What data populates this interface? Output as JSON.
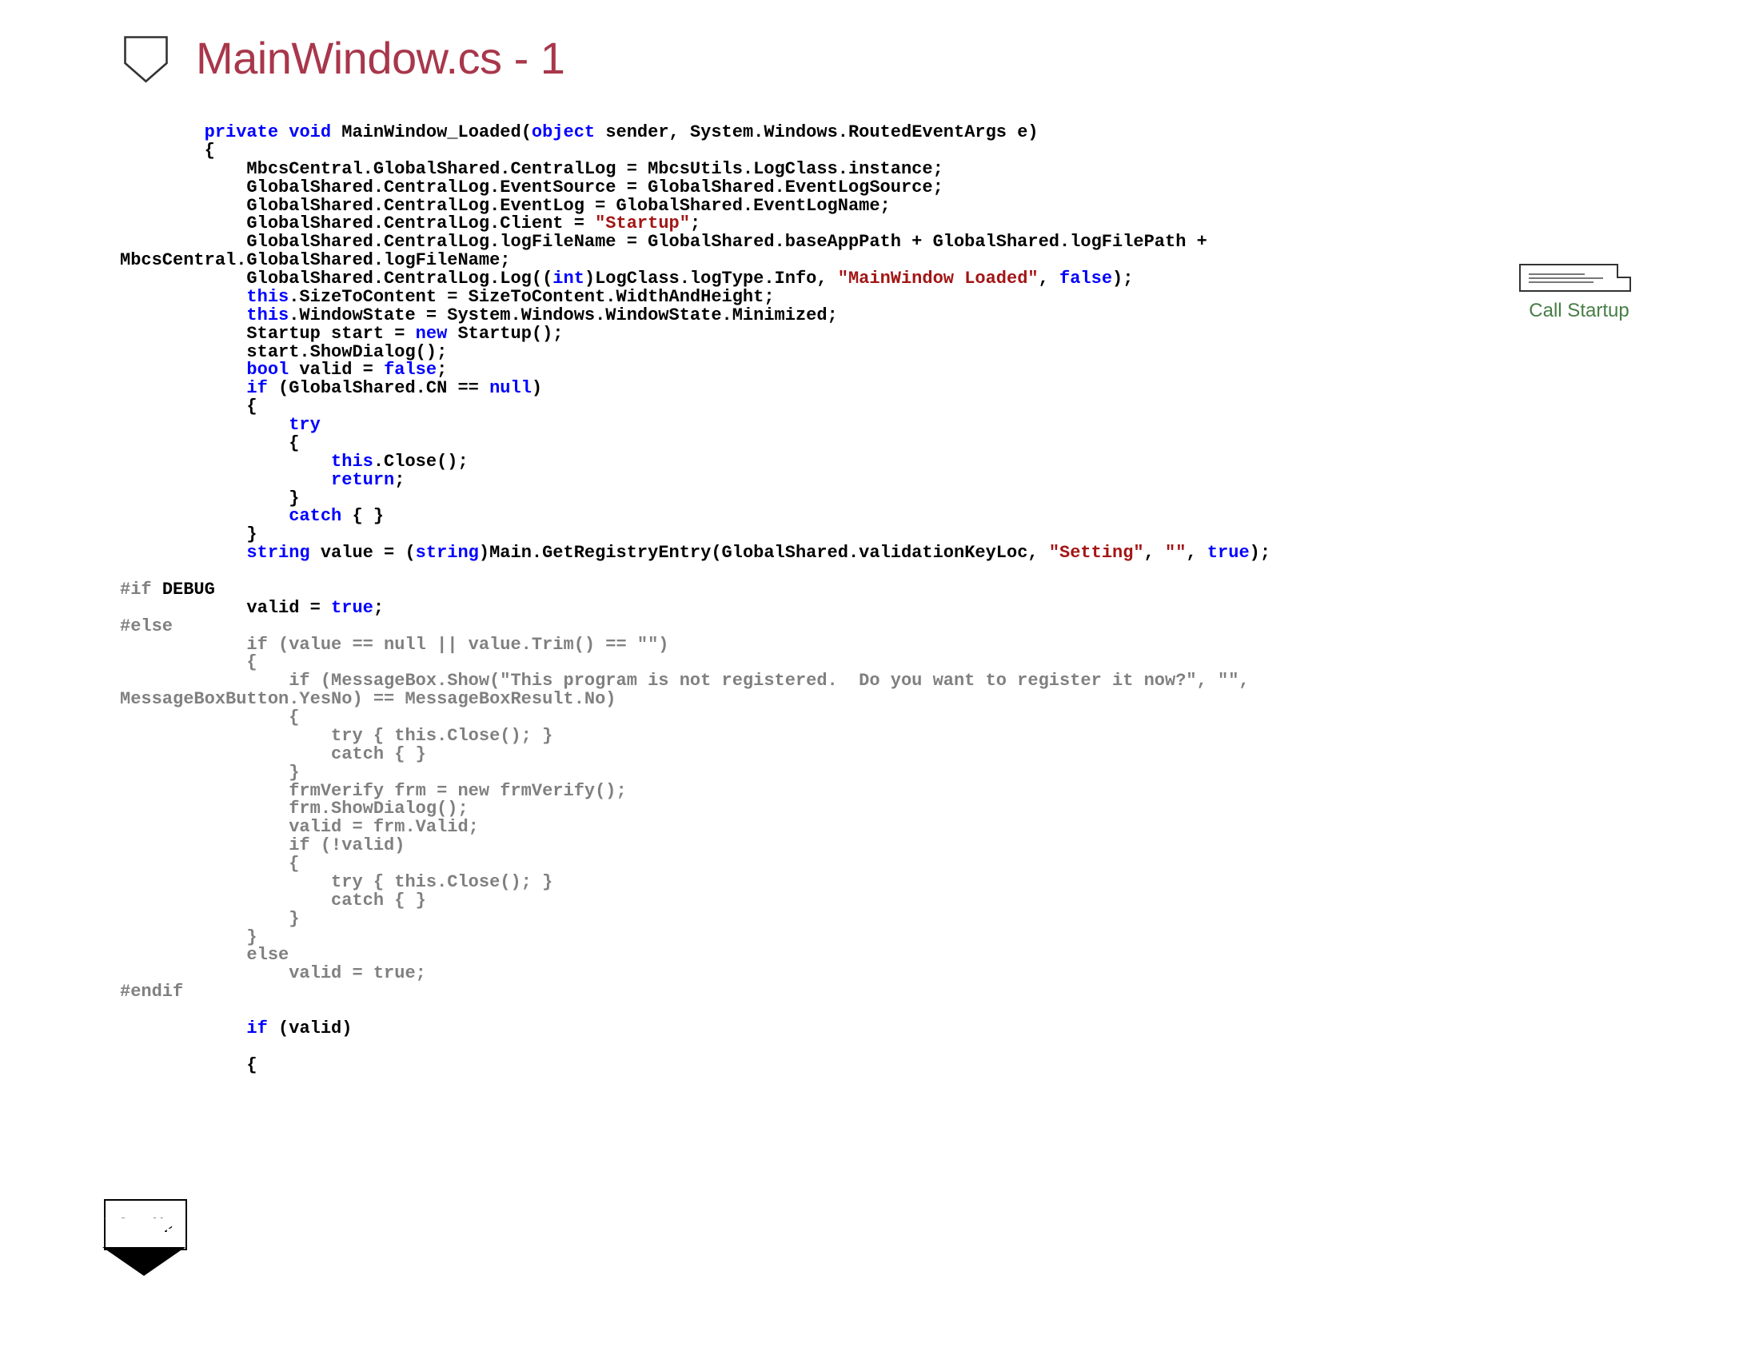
{
  "header": {
    "title": "MainWindow.cs - 1"
  },
  "callout": {
    "label": "Call Startup"
  },
  "startup_badge": {
    "label": "StartUp"
  },
  "code": {
    "l1a": "        private",
    "l1b": " void",
    "l1c": " MainWindow_Loaded(",
    "l1d": "object",
    "l1e": " sender, System.Windows.RoutedEventArgs e)",
    "l2": "        {",
    "l3": "            MbcsCentral.GlobalShared.CentralLog = MbcsUtils.LogClass.instance;",
    "l4": "            GlobalShared.CentralLog.EventSource = GlobalShared.EventLogSource;",
    "l5": "            GlobalShared.CentralLog.EventLog = GlobalShared.EventLogName;",
    "l6a": "            GlobalShared.CentralLog.Client = ",
    "l6b": "\"Startup\"",
    "l6c": ";",
    "l7": "            GlobalShared.CentralLog.logFileName = GlobalShared.baseAppPath + GlobalShared.logFilePath + ",
    "l7b": "MbcsCentral.GlobalShared.logFileName;",
    "l8a": "            GlobalShared.CentralLog.Log((",
    "l8b": "int",
    "l8c": ")LogClass.logType.Info, ",
    "l8d": "\"MainWindow Loaded\"",
    "l8e": ", ",
    "l8f": "false",
    "l8g": ");",
    "l9a": "            this",
    "l9b": ".SizeToContent = SizeToContent.WidthAndHeight;",
    "l10a": "            this",
    "l10b": ".WindowState = System.Windows.WindowState.Minimized;",
    "l11a": "            Startup start = ",
    "l11b": "new",
    "l11c": " Startup();",
    "l12": "            start.ShowDialog();",
    "l13a": "            bool",
    "l13b": " valid = ",
    "l13c": "false",
    "l13d": ";",
    "l14a": "            if",
    "l14b": " (GlobalShared.CN == ",
    "l14c": "null",
    "l14d": ")",
    "l15": "            {",
    "l16": "                try",
    "l17": "                {",
    "l18a": "                    this",
    "l18b": ".Close();",
    "l19": "                    return",
    "l19b": ";",
    "l20": "                }",
    "l21a": "                catch",
    "l21b": " { }",
    "l22": "            }",
    "l23a": "            string",
    "l23b": " value = (",
    "l23c": "string",
    "l23d": ")Main.GetRegistryEntry(GlobalShared.validationKeyLoc, ",
    "l23e": "\"Setting\"",
    "l23f": ", ",
    "l23g": "\"\"",
    "l23h": ", ",
    "l23i": "true",
    "l23j": ");",
    "blank": "",
    "l24a": "#if ",
    "l24b": "DEBUG",
    "l25a": "            valid = ",
    "l25b": "true",
    "l25c": ";",
    "l26": "#else",
    "l27": "            if (value == null || value.Trim() == \"\")",
    "l28": "            {",
    "l29": "                if (MessageBox.Show(\"This program is not registered.  Do you want to register it now?\", \"\", ",
    "l29b": "MessageBoxButton.YesNo) == MessageBoxResult.No)",
    "l30": "                {",
    "l31": "                    try { this.Close(); }",
    "l32": "                    catch { }",
    "l33": "                }",
    "l34": "                frmVerify frm = new frmVerify();",
    "l35": "                frm.ShowDialog();",
    "l36": "                valid = frm.Valid;",
    "l37": "                if (!valid)",
    "l38": "                {",
    "l39": "                    try { this.Close(); }",
    "l40": "                    catch { }",
    "l41": "                }",
    "l42": "            }",
    "l43": "            else",
    "l44": "                valid = true;",
    "l45": "#endif",
    "l46a": "            if",
    "l46b": " (valid)",
    "l47": "            {"
  }
}
